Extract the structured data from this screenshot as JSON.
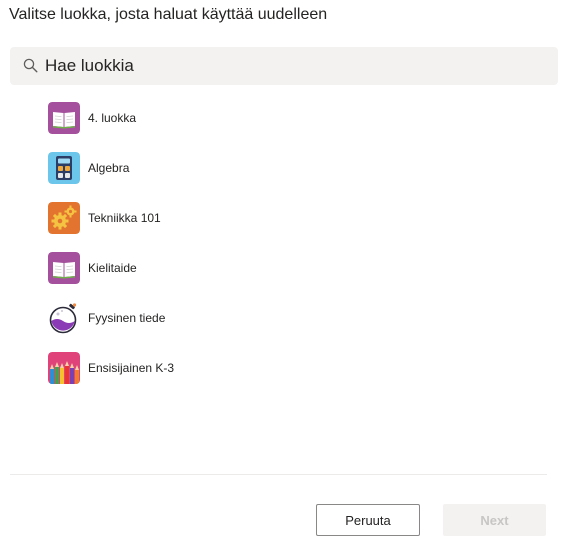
{
  "dialog": {
    "title": "Valitse luokka, josta haluat käyttää uudelleen"
  },
  "search": {
    "placeholder": "Hae luokkia",
    "icon": "search-icon"
  },
  "classes": [
    {
      "label": "4. luokka",
      "icon": "book-icon",
      "color": "#a4509c"
    },
    {
      "label": "Algebra",
      "icon": "calculator-icon",
      "color": "#6cc5ea"
    },
    {
      "label": "Tekniikka 101",
      "icon": "gears-icon",
      "color": "#e3742f"
    },
    {
      "label": "Kielitaide",
      "icon": "book-icon",
      "color": "#a4509c"
    },
    {
      "label": "Fyysinen tiede",
      "icon": "flask-icon",
      "color": "#8a3bb5"
    },
    {
      "label": "Ensisijainen K-3",
      "icon": "crayons-icon",
      "color": "#e0427a"
    }
  ],
  "footer": {
    "cancel_label": "Peruuta",
    "next_label": "Next"
  }
}
